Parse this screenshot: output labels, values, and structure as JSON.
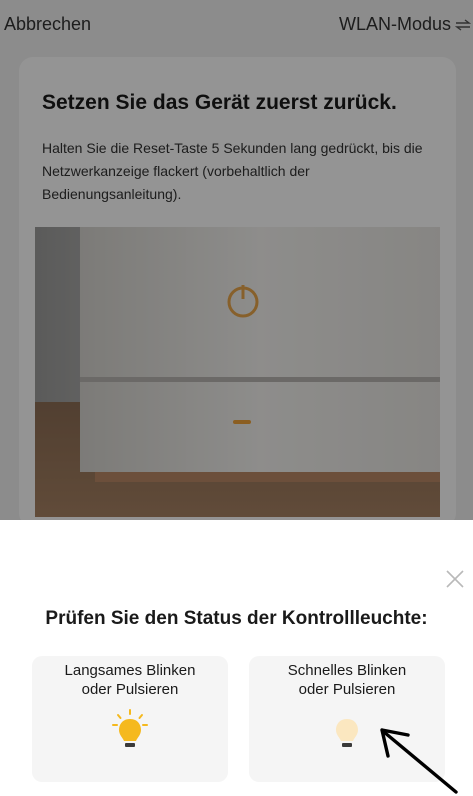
{
  "topbar": {
    "cancel_label": "Abbrechen",
    "mode_label": "WLAN-Modus",
    "mode_icon": "swap-arrows-icon"
  },
  "card": {
    "title": "Setzen Sie das Gerät zuerst zurück.",
    "description": "Halten Sie die Reset-Taste 5 Sekunden lang gedrückt, bis die Netzwerkanzeige flackert (vorbehaltlich der Bedienungsanleitung).",
    "image": "device-reset-photo"
  },
  "sheet": {
    "title": "Prüfen Sie den Status der Kontrollleuchte:",
    "close_icon": "close-icon",
    "options": [
      {
        "label_line1": "Langsames Blinken",
        "label_line2": "oder Pulsieren",
        "icon": "bulb-on-icon"
      },
      {
        "label_line1": "Schnelles Blinken",
        "label_line2": "oder Pulsieren",
        "icon": "bulb-dim-icon"
      }
    ]
  },
  "colors": {
    "bulb_yellow": "#f5b91e",
    "bulb_pale": "#fbe7c0",
    "overlay": "#000000"
  }
}
